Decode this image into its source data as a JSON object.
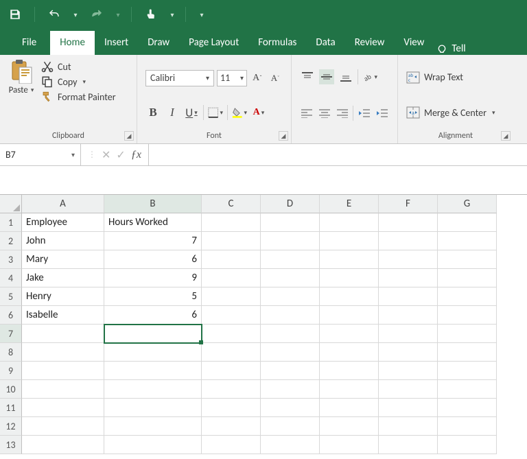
{
  "qat": {
    "undo_tooltip": "Undo",
    "redo_tooltip": "Redo",
    "save_tooltip": "Save",
    "touch_tooltip": "Touch/Mouse Mode"
  },
  "tabs": {
    "file": "File",
    "home": "Home",
    "insert": "Insert",
    "draw": "Draw",
    "page_layout": "Page Layout",
    "formulas": "Formulas",
    "data": "Data",
    "review": "Review",
    "view": "View",
    "tellme": "Tell"
  },
  "ribbon": {
    "clipboard": {
      "paste": "Paste",
      "cut": "Cut",
      "copy": "Copy",
      "format_painter": "Format Painter",
      "label": "Clipboard"
    },
    "font": {
      "name": "Calibri",
      "size": "11",
      "bold": "B",
      "italic": "I",
      "underline": "U",
      "label": "Font"
    },
    "alignment": {
      "wrap": "Wrap Text",
      "merge": "Merge & Center",
      "label": "Alignment"
    }
  },
  "namebox": "B7",
  "formula": "",
  "columns": [
    "A",
    "B",
    "C",
    "D",
    "E",
    "F",
    "G"
  ],
  "rows": [
    "1",
    "2",
    "3",
    "4",
    "5",
    "6",
    "7",
    "8",
    "9",
    "10",
    "11",
    "12",
    "13"
  ],
  "data": {
    "A1": "Employee",
    "B1": "Hours Worked",
    "A2": "John",
    "B2": "7",
    "A3": "Mary",
    "B3": "6",
    "A4": "Jake",
    "B4": "9",
    "A5": "Henry",
    "B5": "5",
    "A6": "Isabelle",
    "B6": "6"
  },
  "selection": {
    "col": "B",
    "row": "7"
  }
}
